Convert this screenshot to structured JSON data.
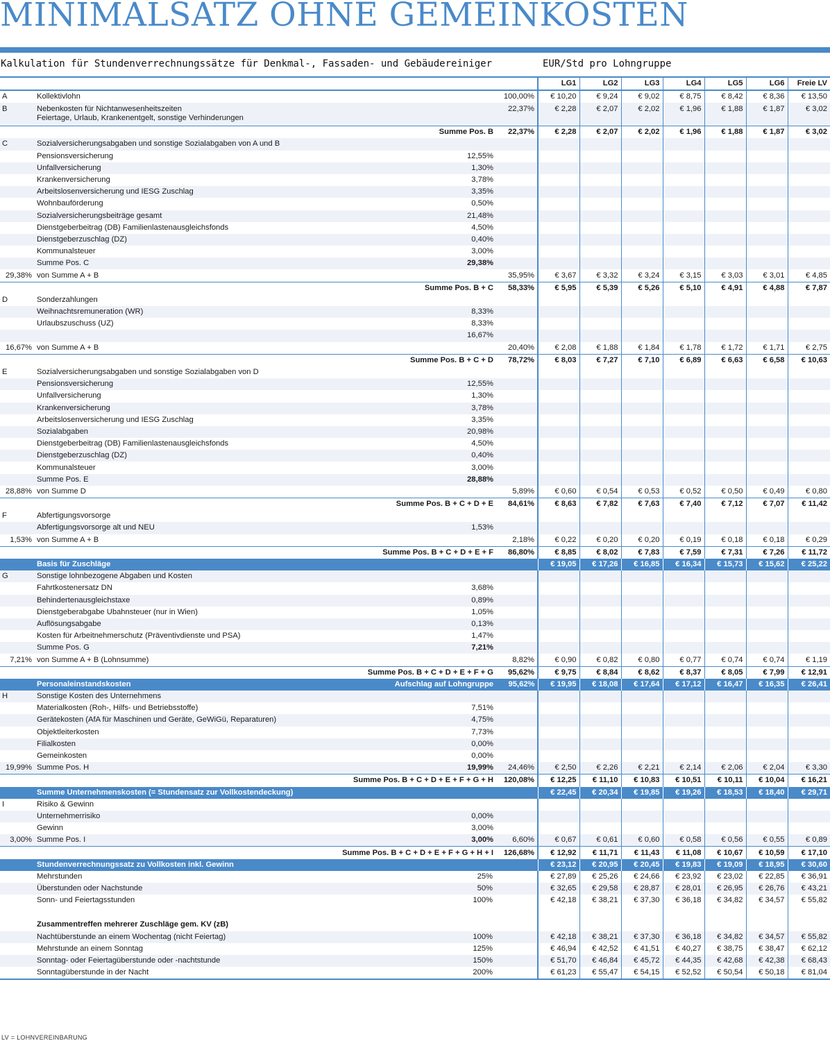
{
  "title": "MINIMALSATZ OHNE GEMEINKOSTEN",
  "subtitle": "Kalkulation für Stundenverrechnungssätze für Denkmal-, Fassaden- und Gebäudereiniger",
  "unit_label": "EUR/Std pro Lohngruppe",
  "columns": [
    "LG1",
    "LG2",
    "LG3",
    "LG4",
    "LG5",
    "LG6",
    "Freie LV"
  ],
  "footnote": "LV = LOHNVEREINBARUNG",
  "colors": {
    "accent": "#4a8ac9",
    "stripe": "#eef2f8"
  },
  "rows": [
    {
      "type": "data",
      "code": "A",
      "label": "Kollektivlohn",
      "pct": "",
      "rate": "100,00%",
      "values": [
        "€ 10,20",
        "€ 9,24",
        "€ 9,02",
        "€ 8,75",
        "€ 8,42",
        "€ 8,36",
        "€ 13,50"
      ]
    },
    {
      "type": "data2",
      "code": "B",
      "label": "Nebenkosten für Nichtanwesenheitszeiten",
      "label2": "Feiertage, Urlaub, Krankenentgelt, sonstige Verhinderungen",
      "pct": "",
      "rate": "22,37%",
      "values": [
        "€ 2,28",
        "€ 2,07",
        "€ 2,02",
        "€ 1,96",
        "€ 1,88",
        "€ 1,87",
        "€ 3,02"
      ]
    },
    {
      "type": "sum",
      "label": "Summe Pos. B",
      "rate": "22,37%",
      "values": [
        "€ 2,28",
        "€ 2,07",
        "€ 2,02",
        "€ 1,96",
        "€ 1,88",
        "€ 1,87",
        "€ 3,02"
      ]
    },
    {
      "type": "data",
      "code": "C",
      "label": "Sozialversicherungsabgaben und sonstige Sozialabgaben von A und B"
    },
    {
      "type": "data",
      "label": "Pensionsversicherung",
      "pct": "12,55%"
    },
    {
      "type": "data",
      "label": "Unfallversicherung",
      "pct": "1,30%"
    },
    {
      "type": "data",
      "label": "Krankenversicherung",
      "pct": "3,78%"
    },
    {
      "type": "data",
      "label": "Arbeitslosenversicherung und IESG Zuschlag",
      "pct": "3,35%"
    },
    {
      "type": "data",
      "label": "Wohnbauförderung",
      "pct": "0,50%"
    },
    {
      "type": "data",
      "label": "Sozialversicherungsbeiträge gesamt",
      "pct": "21,48%"
    },
    {
      "type": "data",
      "label": "Dienstgeberbeitrag (DB) Familienlastenausgleichsfonds",
      "pct": "4,50%"
    },
    {
      "type": "data",
      "label": "Dienstgeberzuschlag (DZ)",
      "pct": "0,40%"
    },
    {
      "type": "data",
      "label": "Kommunalsteuer",
      "pct": "3,00%"
    },
    {
      "type": "data",
      "label": "Summe Pos. C",
      "pct": "29,38%",
      "pct_bold": true
    },
    {
      "type": "data",
      "code": "29,38%",
      "code_right": true,
      "label": "von Summe A + B",
      "rate": "35,95%",
      "values": [
        "€ 3,67",
        "€ 3,32",
        "€ 3,24",
        "€ 3,15",
        "€ 3,03",
        "€ 3,01",
        "€ 4,85"
      ]
    },
    {
      "type": "sum",
      "label": "Summe Pos. B + C",
      "rate": "58,33%",
      "values": [
        "€ 5,95",
        "€ 5,39",
        "€ 5,26",
        "€ 5,10",
        "€ 4,91",
        "€ 4,88",
        "€ 7,87"
      ]
    },
    {
      "type": "data",
      "code": "D",
      "label": "Sonderzahlungen"
    },
    {
      "type": "data",
      "label": "Weihnachtsremuneration (WR)",
      "pct": "8,33%"
    },
    {
      "type": "data",
      "label": "Urlaubszuschuss (UZ)",
      "pct": "8,33%"
    },
    {
      "type": "data",
      "label": "",
      "pct": "16,67%"
    },
    {
      "type": "data",
      "code": "16,67%",
      "code_right": true,
      "label": "von Summe A + B",
      "rate": "20,40%",
      "values": [
        "€ 2,08",
        "€ 1,88",
        "€ 1,84",
        "€ 1,78",
        "€ 1,72",
        "€ 1,71",
        "€ 2,75"
      ]
    },
    {
      "type": "sum",
      "label": "Summe Pos. B + C + D",
      "rate": "78,72%",
      "values": [
        "€ 8,03",
        "€ 7,27",
        "€ 7,10",
        "€ 6,89",
        "€ 6,63",
        "€ 6,58",
        "€ 10,63"
      ]
    },
    {
      "type": "data",
      "code": "E",
      "label": "Sozialversicherungsabgaben und sonstige Sozialabgaben von D"
    },
    {
      "type": "data",
      "label": "Pensionsversicherung",
      "pct": "12,55%"
    },
    {
      "type": "data",
      "label": "Unfallversicherung",
      "pct": "1,30%"
    },
    {
      "type": "data",
      "label": "Krankenversicherung",
      "pct": "3,78%"
    },
    {
      "type": "data",
      "label": "Arbeitslosenversicherung und IESG Zuschlag",
      "pct": "3,35%"
    },
    {
      "type": "data",
      "label": "Sozialabgaben",
      "pct": "20,98%"
    },
    {
      "type": "data",
      "label": "Dienstgeberbeitrag (DB) Familienlastenausgleichsfonds",
      "pct": "4,50%"
    },
    {
      "type": "data",
      "label": "Dienstgeberzuschlag (DZ)",
      "pct": "0,40%"
    },
    {
      "type": "data",
      "label": "Kommunalsteuer",
      "pct": "3,00%"
    },
    {
      "type": "data",
      "label": "Summe Pos. E",
      "pct": "28,88%",
      "pct_bold": true
    },
    {
      "type": "data",
      "code": "28,88%",
      "code_right": true,
      "label": "von Summe D",
      "rate": "5,89%",
      "values": [
        "€ 0,60",
        "€ 0,54",
        "€ 0,53",
        "€ 0,52",
        "€ 0,50",
        "€ 0,49",
        "€ 0,80"
      ]
    },
    {
      "type": "sum",
      "label": "Summe Pos. B + C + D + E",
      "rate": "84,61%",
      "values": [
        "€ 8,63",
        "€ 7,82",
        "€ 7,63",
        "€ 7,40",
        "€ 7,12",
        "€ 7,07",
        "€ 11,42"
      ]
    },
    {
      "type": "data",
      "code": "F",
      "label": "Abfertigungsvorsorge"
    },
    {
      "type": "data",
      "label": "Abfertigungsvorsorge alt und NEU",
      "pct": "1,53%"
    },
    {
      "type": "data",
      "code": "1,53%",
      "code_right": true,
      "label": "von Summe A + B",
      "rate": "2,18%",
      "values": [
        "€ 0,22",
        "€ 0,20",
        "€ 0,20",
        "€ 0,19",
        "€ 0,18",
        "€ 0,18",
        "€ 0,29"
      ]
    },
    {
      "type": "sum",
      "label": "Summe Pos. B + C + D + E + F",
      "rate": "86,80%",
      "values": [
        "€ 8,85",
        "€ 8,02",
        "€ 7,83",
        "€ 7,59",
        "€ 7,31",
        "€ 7,26",
        "€ 11,72"
      ]
    },
    {
      "type": "band",
      "label": "Basis für Zuschläge",
      "values": [
        "€ 19,05",
        "€ 17,26",
        "€ 16,85",
        "€ 16,34",
        "€ 15,73",
        "€ 15,62",
        "€ 25,22"
      ]
    },
    {
      "type": "data",
      "code": "G",
      "label": "Sonstige lohnbezogene Abgaben und Kosten"
    },
    {
      "type": "data",
      "label": "Fahrtkostenersatz DN",
      "pct": "3,68%"
    },
    {
      "type": "data",
      "label": "Behindertenausgleichstaxe",
      "pct": "0,89%"
    },
    {
      "type": "data",
      "label": "Dienstgeberabgabe Ubahnsteuer (nur in Wien)",
      "pct": "1,05%"
    },
    {
      "type": "data",
      "label": "Auflösungsabgabe",
      "pct": "0,13%"
    },
    {
      "type": "data",
      "label": "Kosten für Arbeitnehmerschutz (Präventivdienste und PSA)",
      "pct": "1,47%"
    },
    {
      "type": "data",
      "label": "Summe Pos. G",
      "pct": "7,21%",
      "pct_bold": true
    },
    {
      "type": "data",
      "code": "7,21%",
      "code_right": true,
      "label": "von Summe A + B (Lohnsumme)",
      "rate": "8,82%",
      "values": [
        "€ 0,90",
        "€ 0,82",
        "€ 0,80",
        "€ 0,77",
        "€ 0,74",
        "€ 0,74",
        "€ 1,19"
      ]
    },
    {
      "type": "sum",
      "label": "Summe Pos. B + C + D + E + F + G",
      "rate": "95,62%",
      "values": [
        "€ 9,75",
        "€ 8,84",
        "€ 8,62",
        "€ 8,37",
        "€ 8,05",
        "€ 7,99",
        "€ 12,91"
      ]
    },
    {
      "type": "band",
      "label": "Personaleinstandskosten",
      "mid": "Aufschlag auf Lohngruppe",
      "midpct": "95,62%",
      "values": [
        "€ 19,95",
        "€ 18,08",
        "€ 17,64",
        "€ 17,12",
        "€ 16,47",
        "€ 16,35",
        "€ 26,41"
      ]
    },
    {
      "type": "data",
      "code": "H",
      "label": "Sonstige Kosten des Unternehmens"
    },
    {
      "type": "data",
      "label": "Materialkosten (Roh-, Hilfs- und Betriebsstoffe)",
      "pct": "7,51%"
    },
    {
      "type": "data",
      "label": "Gerätekosten (AfA für Maschinen und Geräte, GeWiGü, Reparaturen)",
      "pct": "4,75%"
    },
    {
      "type": "data",
      "label": "Objektleiterkosten",
      "pct": "7,73%"
    },
    {
      "type": "data",
      "label": "Filialkosten",
      "pct": "0,00%"
    },
    {
      "type": "data",
      "label": "Gemeinkosten",
      "pct": "0,00%"
    },
    {
      "type": "data",
      "code": "19,99%",
      "code_right": true,
      "label": "Summe Pos. H",
      "pct": "19,99%",
      "pct_bold": true,
      "rate": "24,46%",
      "values": [
        "€ 2,50",
        "€ 2,26",
        "€ 2,21",
        "€ 2,14",
        "€ 2,06",
        "€ 2,04",
        "€ 3,30"
      ]
    },
    {
      "type": "sum",
      "label": "Summe Pos. B + C + D + E + F + G + H",
      "rate": "120,08%",
      "values": [
        "€ 12,25",
        "€ 11,10",
        "€ 10,83",
        "€ 10,51",
        "€ 10,11",
        "€ 10,04",
        "€ 16,21"
      ]
    },
    {
      "type": "band",
      "label": "Summe Unternehmenskosten (= Stundensatz zur Vollkostendeckung)",
      "values": [
        "€ 22,45",
        "€ 20,34",
        "€ 19,85",
        "€ 19,26",
        "€ 18,53",
        "€ 18,40",
        "€ 29,71"
      ]
    },
    {
      "type": "data",
      "code": "I",
      "label": "Risiko & Gewinn"
    },
    {
      "type": "data",
      "label": "Unternehmerrisiko",
      "pct": "0,00%"
    },
    {
      "type": "data",
      "label": "Gewinn",
      "pct": "3,00%"
    },
    {
      "type": "data",
      "code": "3,00%",
      "code_right": true,
      "label": "Summe Pos. I",
      "pct": "3,00%",
      "pct_bold": true,
      "rate": "6,60%",
      "values": [
        "€ 0,67",
        "€ 0,61",
        "€ 0,60",
        "€ 0,58",
        "€ 0,56",
        "€ 0,55",
        "€ 0,89"
      ]
    },
    {
      "type": "sum",
      "label": "Summe Pos. B + C + D + E + F + G + H + I",
      "rate": "126,68%",
      "values": [
        "€ 12,92",
        "€ 11,71",
        "€ 11,43",
        "€ 11,08",
        "€ 10,67",
        "€ 10,59",
        "€ 17,10"
      ]
    },
    {
      "type": "band",
      "label": "Stundenverrechnungssatz zu Vollkosten inkl. Gewinn",
      "values": [
        "€ 23,12",
        "€ 20,95",
        "€ 20,45",
        "€ 19,83",
        "€ 19,09",
        "€ 18,95",
        "€ 30,60"
      ]
    },
    {
      "type": "data",
      "label": "Mehrstunden",
      "mid": "25%",
      "values": [
        "€ 27,89",
        "€ 25,26",
        "€ 24,66",
        "€ 23,92",
        "€ 23,02",
        "€ 22,85",
        "€ 36,91"
      ]
    },
    {
      "type": "data",
      "label": "Überstunden oder Nachstunde",
      "mid": "50%",
      "values": [
        "€ 32,65",
        "€ 29,58",
        "€ 28,87",
        "€ 28,01",
        "€ 26,95",
        "€ 26,76",
        "€ 43,21"
      ]
    },
    {
      "type": "data",
      "label": "Sonn- und Feiertagsstunden",
      "mid": "100%",
      "values": [
        "€ 42,18",
        "€ 38,21",
        "€ 37,30",
        "€ 36,18",
        "€ 34,82",
        "€ 34,57",
        "€ 55,82"
      ]
    },
    {
      "type": "spacer"
    },
    {
      "type": "data",
      "label": "Zusammentreffen mehrerer Zuschläge gem. KV (zB)",
      "label_bold": true
    },
    {
      "type": "data",
      "label": "Nachtüberstunde an einem Wochentag (nicht Feiertag)",
      "mid": "100%",
      "values": [
        "€ 42,18",
        "€ 38,21",
        "€ 37,30",
        "€ 36,18",
        "€ 34,82",
        "€ 34,57",
        "€ 55,82"
      ]
    },
    {
      "type": "data",
      "label": "Mehrstunde an einem Sonntag",
      "mid": "125%",
      "values": [
        "€ 46,94",
        "€ 42,52",
        "€ 41,51",
        "€ 40,27",
        "€ 38,75",
        "€ 38,47",
        "€ 62,12"
      ]
    },
    {
      "type": "data",
      "label": "Sonntag- oder Feiertagüberstunde oder -nachtstunde",
      "mid": "150%",
      "values": [
        "€ 51,70",
        "€ 46,84",
        "€ 45,72",
        "€ 44,35",
        "€ 42,68",
        "€ 42,38",
        "€ 68,43"
      ]
    },
    {
      "type": "data",
      "label": "Sonntagüberstunde in der Nacht",
      "mid": "200%",
      "values": [
        "€ 61,23",
        "€ 55,47",
        "€ 54,15",
        "€ 52,52",
        "€ 50,54",
        "€ 50,18",
        "€ 81,04"
      ]
    }
  ]
}
